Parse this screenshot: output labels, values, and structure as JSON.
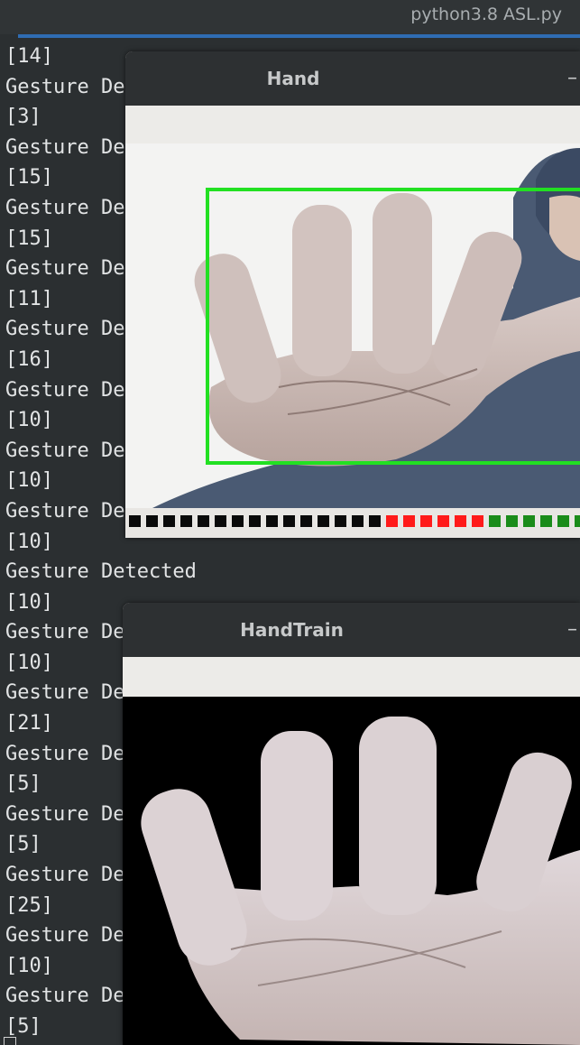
{
  "app": {
    "title": "python3.8 ASL.py"
  },
  "terminal": {
    "lines": [
      "[14]",
      "Gesture Detected",
      "[3]",
      "Gesture Detected",
      "[15]",
      "Gesture Detected",
      "[15]",
      "Gesture Detected",
      "[11]",
      "Gesture Detected",
      "[16]",
      "Gesture Detected",
      "[10]",
      "Gesture Detected",
      "[10]",
      "Gesture Detected",
      "[10]",
      "Gesture Detected",
      "[10]",
      "Gesture Detected",
      "[10]",
      "Gesture Detected",
      "[21]",
      "Gesture Detected",
      "[5]",
      "Gesture Detected",
      "[5]",
      "Gesture Detected",
      "[25]",
      "Gesture Detected",
      "[10]",
      "Gesture Detected",
      "[5]"
    ]
  },
  "windows": {
    "hand": {
      "title": "Hand",
      "minimize": "–",
      "bounding_box_color": "#22e022"
    },
    "hand_train": {
      "title": "HandTrain",
      "minimize": "–"
    }
  },
  "trackbar": {
    "segments": 28,
    "black": 15,
    "red": 6,
    "green": 7,
    "colors": {
      "black": "#0a0a0a",
      "red": "#ff1a1a",
      "green": "#1a8c1a"
    }
  }
}
